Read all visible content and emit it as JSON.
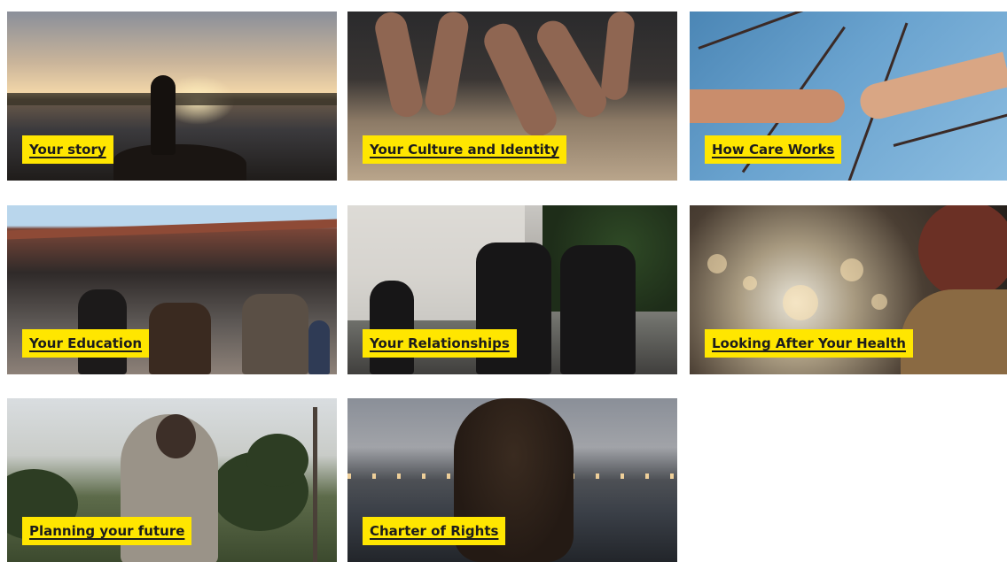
{
  "tiles": [
    {
      "label": "Your story"
    },
    {
      "label": "Your Culture and Identity"
    },
    {
      "label": "How Care Works"
    },
    {
      "label": "Your Education"
    },
    {
      "label": "Your Relationships"
    },
    {
      "label": "Looking After Your Health"
    },
    {
      "label": "Planning your future"
    },
    {
      "label": "Charter of Rights"
    }
  ],
  "colors": {
    "label_background": "#ffe600",
    "label_text": "#1c1c1c",
    "page_background": "#ffffff"
  }
}
